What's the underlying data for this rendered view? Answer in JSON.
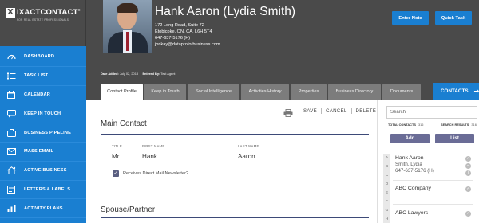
{
  "brand": {
    "logo_x": "X",
    "name": "IXACTCONTACT",
    "registered": "®",
    "tagline": "FOR REAL ESTATE PROFESSIONALS"
  },
  "sidebar": {
    "items": [
      {
        "label": "DASHBOARD",
        "icon": "dashboard-icon"
      },
      {
        "label": "TASK LIST",
        "icon": "task-list-icon"
      },
      {
        "label": "CALENDAR",
        "icon": "calendar-icon"
      },
      {
        "label": "KEEP IN TOUCH",
        "icon": "keep-in-touch-icon"
      },
      {
        "label": "BUSINESS PIPELINE",
        "icon": "business-pipeline-icon"
      },
      {
        "label": "MASS EMAIL",
        "icon": "mail-icon"
      },
      {
        "label": "ACTIVE BUSINESS",
        "icon": "active-business-icon"
      },
      {
        "label": "LETTERS & LABELS",
        "icon": "letters-labels-icon"
      },
      {
        "label": "ACTIVITY PLANS",
        "icon": "activity-plans-icon"
      }
    ]
  },
  "contact": {
    "name": "Hank Aaron (Lydia Smith)",
    "address_line1": "172 Long Road, Suite 72",
    "address_line2": "Etobicoke, ON, CA, L6H 5T4",
    "phone": "647-637-5176 (H)",
    "email": "jonkay@dataproforbusiness.com",
    "date_added_label": "Date Added:",
    "date_added": "July 02, 2013",
    "entered_by_label": "Entered By:",
    "entered_by": "Test Agent"
  },
  "header": {
    "enter_note": "Enter Note",
    "quick_task": "Quick Task"
  },
  "tabs": [
    {
      "label": "Contact Profile",
      "active": true
    },
    {
      "label": "Keep in Touch",
      "active": false
    },
    {
      "label": "Social Intelligence",
      "active": false
    },
    {
      "label": "Activities/History",
      "active": false
    },
    {
      "label": "Properties",
      "active": false
    },
    {
      "label": "Business Directory",
      "active": false
    },
    {
      "label": "Documents",
      "active": false
    }
  ],
  "contacts_button": {
    "label": "CONTACTS",
    "arrow": "→"
  },
  "toolbar": {
    "save": "SAVE",
    "cancel": "CANCEL",
    "delete": "DELETE"
  },
  "main_contact": {
    "section_title": "Main Contact",
    "title_label": "TITLE",
    "title_value": "Mr.",
    "first_name_label": "FIRST NAME",
    "first_name_value": "Hank",
    "last_name_label": "LAST NAME",
    "last_name_value": "Aaron",
    "newsletter_label": "Receives Direct Mail Newsletter?",
    "newsletter_checked": true
  },
  "spouse": {
    "section_title": "Spouse/Partner"
  },
  "right_panel": {
    "search_placeholder": "Search",
    "total_contacts_label": "TOTAL CONTACTS",
    "total_contacts": "316",
    "search_results_label": "SEARCH RESULTS",
    "search_results": "316",
    "add_label": "Add",
    "list_label": "List",
    "alphabet": [
      "A",
      "B",
      "C",
      "D",
      "E",
      "F",
      "G",
      "H"
    ],
    "contacts": [
      {
        "name": "Hank Aaron",
        "line2": "Smith, Lydia",
        "line3": "647-637-5176 (H)"
      },
      {
        "name": "ABC Company"
      },
      {
        "name": "ABC Lawyers"
      }
    ]
  },
  "colors": {
    "sidebar_blue": "#1a7fd1",
    "header_gray": "#4a4a4a",
    "tab_gray": "#7c7c7c",
    "purple_button": "#6a6c96",
    "rule_navy": "#3d4a78"
  }
}
